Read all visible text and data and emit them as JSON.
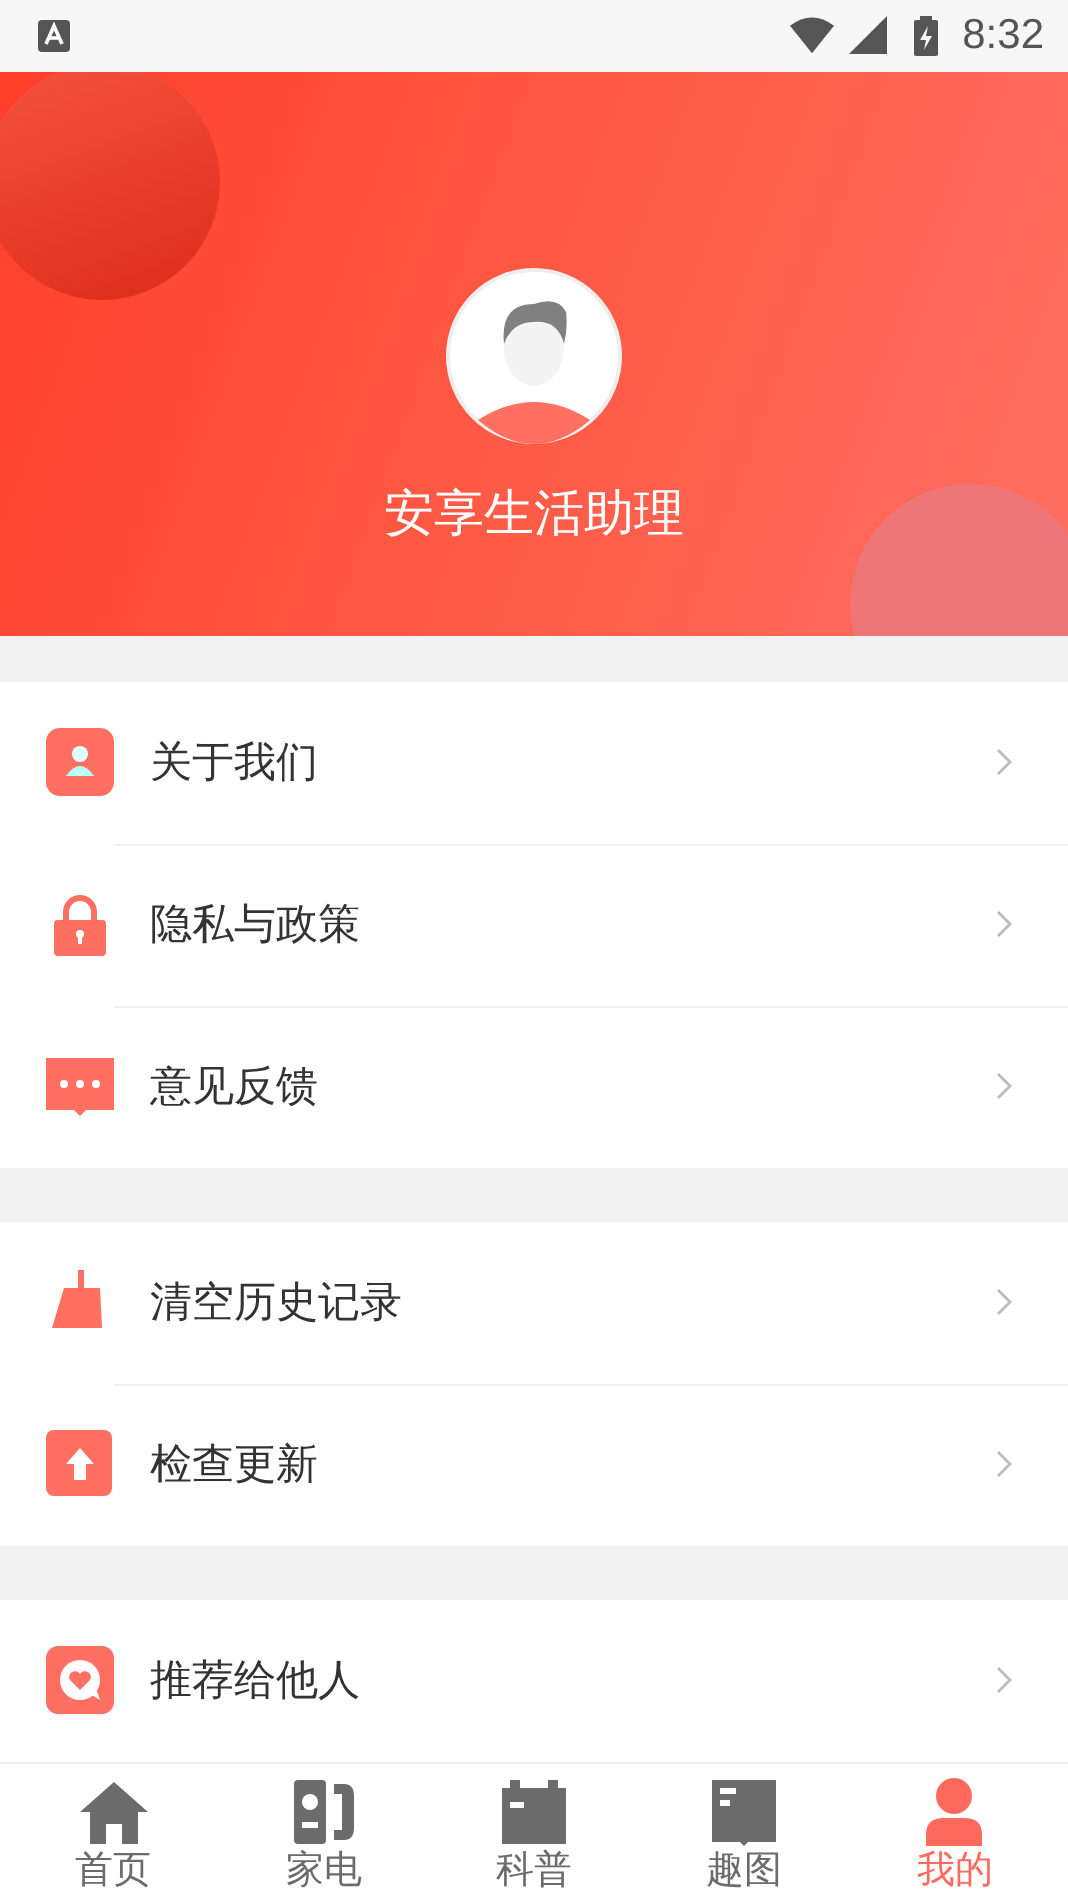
{
  "status_bar": {
    "time": "8:32"
  },
  "profile": {
    "name": "安享生活助理"
  },
  "menu_groups": [
    {
      "items": [
        {
          "label": "关于我们",
          "kind": "person"
        },
        {
          "label": "隐私与政策",
          "kind": "lock"
        },
        {
          "label": "意见反馈",
          "kind": "chat"
        }
      ]
    },
    {
      "items": [
        {
          "label": "清空历史记录",
          "kind": "broom"
        },
        {
          "label": "检查更新",
          "kind": "upload"
        }
      ]
    },
    {
      "items": [
        {
          "label": "推荐给他人",
          "kind": "heart"
        }
      ]
    }
  ],
  "tab_bar": [
    {
      "label": "首页",
      "kind": "home",
      "selected": false
    },
    {
      "label": "家电",
      "kind": "appliance",
      "selected": false
    },
    {
      "label": "科普",
      "kind": "calendar",
      "selected": false
    },
    {
      "label": "趣图",
      "kind": "book",
      "selected": false
    },
    {
      "label": "我的",
      "kind": "user",
      "selected": true
    }
  ]
}
